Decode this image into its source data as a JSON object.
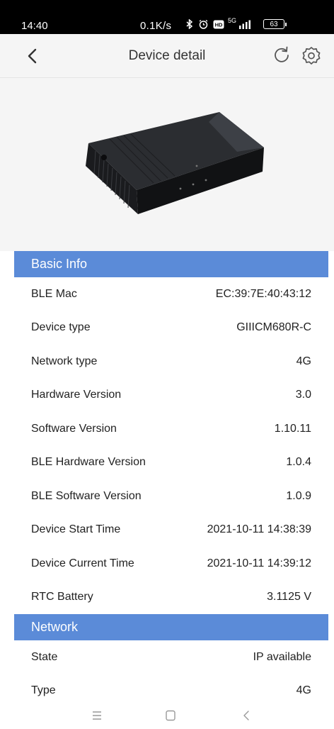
{
  "status_bar": {
    "time": "14:40",
    "net_speed": "0.1K/s",
    "signal": "5G",
    "battery": "63"
  },
  "header": {
    "title": "Device detail"
  },
  "sections": {
    "basic": {
      "title": "Basic Info",
      "rows": [
        {
          "label": "BLE Mac",
          "value": "EC:39:7E:40:43:12"
        },
        {
          "label": "Device type",
          "value": "GIIICM680R-C"
        },
        {
          "label": "Network type",
          "value": "4G"
        },
        {
          "label": "Hardware Version",
          "value": "3.0"
        },
        {
          "label": "Software Version",
          "value": "1.10.11"
        },
        {
          "label": "BLE Hardware Version",
          "value": "1.0.4"
        },
        {
          "label": "BLE Software Version",
          "value": "1.0.9"
        },
        {
          "label": "Device Start Time",
          "value": "2021-10-11 14:38:39"
        },
        {
          "label": "Device Current Time",
          "value": "2021-10-11 14:39:12"
        },
        {
          "label": "RTC Battery",
          "value": "3.1125 V"
        }
      ]
    },
    "network": {
      "title": "Network",
      "rows": [
        {
          "label": "State",
          "value": "IP available"
        },
        {
          "label": "Type",
          "value": "4G"
        }
      ]
    }
  },
  "colors": {
    "section_header": "#5b8bd8",
    "page_background": "#f5f5f5"
  }
}
